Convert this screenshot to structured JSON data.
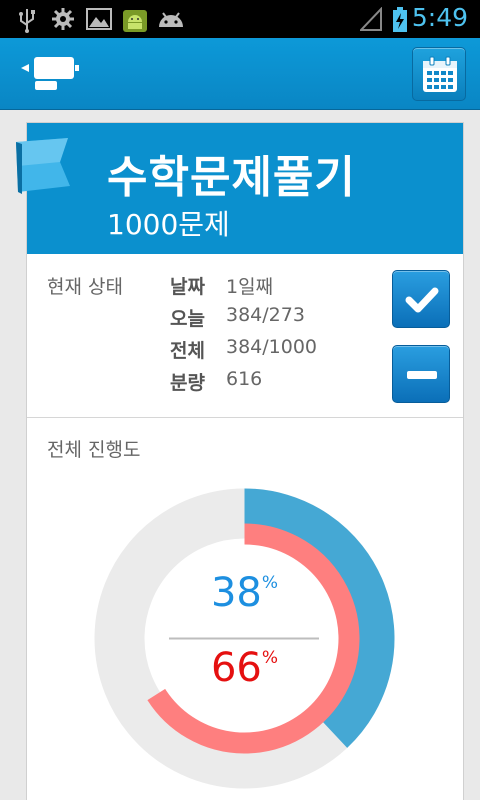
{
  "status_bar": {
    "time": "5:49",
    "icons": [
      "usb-icon",
      "settings-icon",
      "image-icon",
      "android-icon",
      "android-icon",
      "signal-icon",
      "battery-charging-icon"
    ]
  },
  "action_bar": {
    "icons": [
      "app-logo-icon",
      "calendar-icon"
    ]
  },
  "card": {
    "title": "수학문제풀기",
    "subtitle": "1000문제",
    "status_label": "현재 상태",
    "rows": [
      {
        "label": "날짜",
        "value": "1일째"
      },
      {
        "label": "오늘",
        "value": "384/273"
      },
      {
        "label": "전체",
        "value": "384/1000"
      },
      {
        "label": "분량",
        "value": "616"
      }
    ],
    "buttons": [
      "check-icon",
      "minus-icon"
    ]
  },
  "progress": {
    "title": "전체 진행도",
    "outer_percent": "38",
    "inner_percent": "66",
    "percent_symbol": "%",
    "outer_fraction": 0.38,
    "inner_fraction": 0.66,
    "colors": {
      "outer": "#45a8d4",
      "outer_track": "#ebebeb",
      "inner": "#fe7f7f",
      "outer_text": "#1d8fe0",
      "inner_text": "#e51010"
    }
  }
}
